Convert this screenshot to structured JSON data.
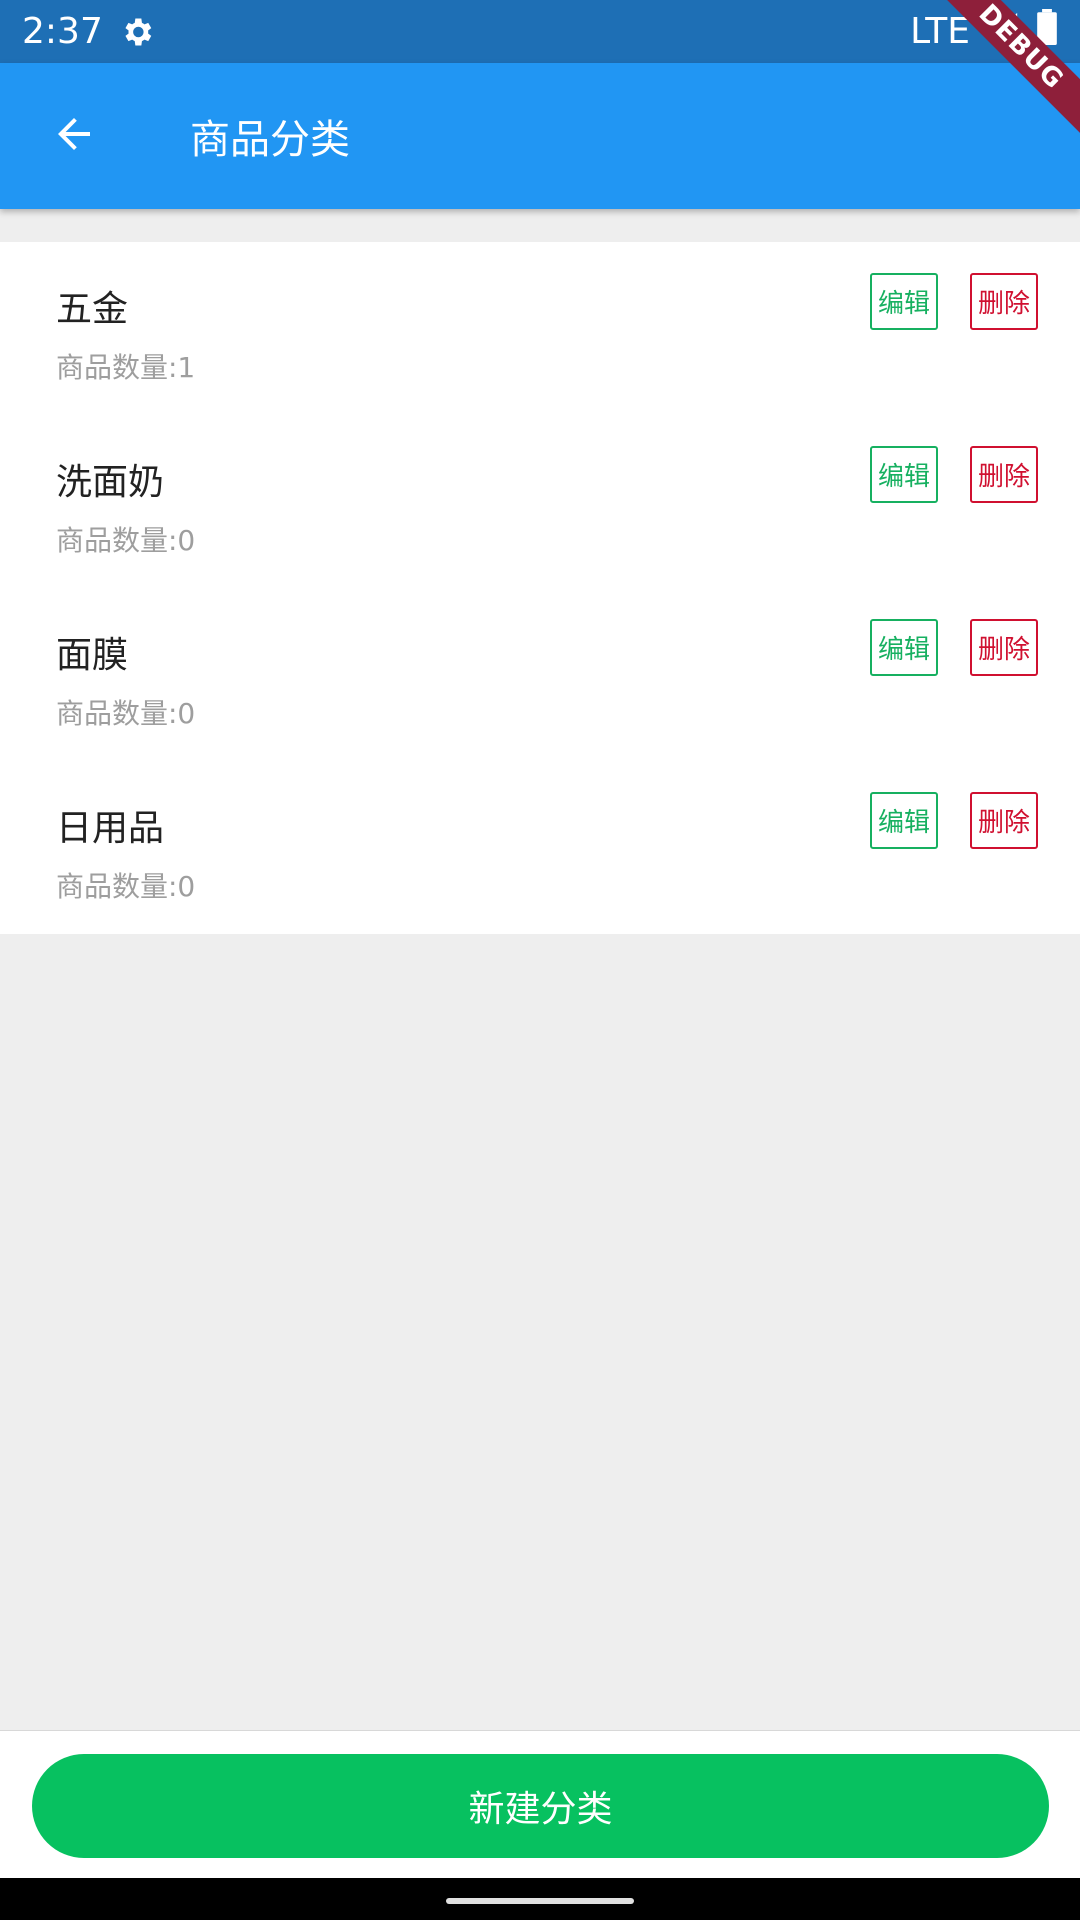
{
  "status_bar": {
    "time": "2:37",
    "network": "LTE",
    "icons": [
      "gear-icon",
      "signal-icon",
      "battery-icon"
    ]
  },
  "app_bar": {
    "title": "商品分类",
    "back_icon": "arrow-back-icon",
    "debug_label": "DEBUG"
  },
  "categories": [
    {
      "name": "五金",
      "count_label": "商品数量:1",
      "edit_label": "编辑",
      "delete_label": "删除"
    },
    {
      "name": "洗面奶",
      "count_label": "商品数量:0",
      "edit_label": "编辑",
      "delete_label": "删除"
    },
    {
      "name": "面膜",
      "count_label": "商品数量:0",
      "edit_label": "编辑",
      "delete_label": "删除"
    },
    {
      "name": "日用品",
      "count_label": "商品数量:0",
      "edit_label": "编辑",
      "delete_label": "删除"
    }
  ],
  "footer": {
    "new_button_label": "新建分类"
  },
  "colors": {
    "app_bar": "#2196f3",
    "status_bar": "#1e6fb5",
    "edit": "#16b060",
    "delete": "#d01030",
    "primary_button": "#07c160"
  }
}
